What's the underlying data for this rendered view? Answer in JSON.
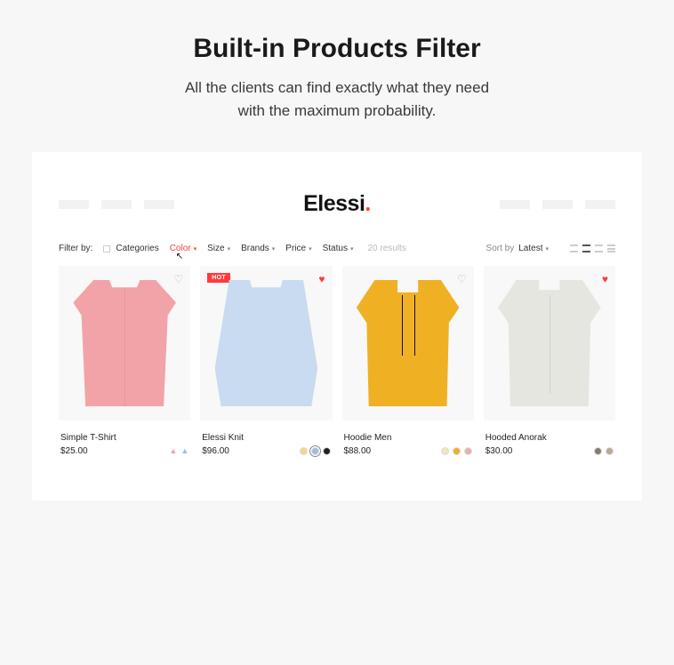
{
  "header": {
    "title": "Built-in Products Filter",
    "subtitle_line1": "All the clients can find exactly what they need",
    "subtitle_line2": "with the maximum probability."
  },
  "brand": {
    "name": "Elessi",
    "dot": "."
  },
  "filters": {
    "label": "Filter by:",
    "categories": "Categories",
    "color": "Color",
    "size": "Size",
    "brands": "Brands",
    "price": "Price",
    "status": "Status",
    "results": "20 results"
  },
  "sort": {
    "label": "Sort by",
    "value": "Latest"
  },
  "products": [
    {
      "name": "Simple T-Shirt",
      "price": "$25.00",
      "badge": null,
      "wished": false,
      "swatches": [
        {
          "type": "icon",
          "glyph": "👕",
          "color": "#f2a3a8"
        },
        {
          "type": "icon",
          "glyph": "👕",
          "color": "#9bbfe4"
        }
      ]
    },
    {
      "name": "Elessi Knit",
      "price": "$96.00",
      "badge": "HOT",
      "wished": true,
      "swatches": [
        {
          "type": "dot",
          "color": "#f4d58d"
        },
        {
          "type": "dot",
          "color": "#9bbfe4"
        },
        {
          "type": "dot",
          "color": "#222222"
        }
      ]
    },
    {
      "name": "Hoodie Men",
      "price": "$88.00",
      "badge": null,
      "wished": false,
      "swatches": [
        {
          "type": "dot",
          "color": "#f3e3c3"
        },
        {
          "type": "dot",
          "color": "#f0b023"
        },
        {
          "type": "dot",
          "color": "#e8b0b0"
        }
      ]
    },
    {
      "name": "Hooded Anorak",
      "price": "$30.00",
      "badge": null,
      "wished": true,
      "swatches": [
        {
          "type": "dot",
          "color": "#8a7a6a"
        },
        {
          "type": "dot",
          "color": "#b8a99a"
        }
      ]
    }
  ]
}
